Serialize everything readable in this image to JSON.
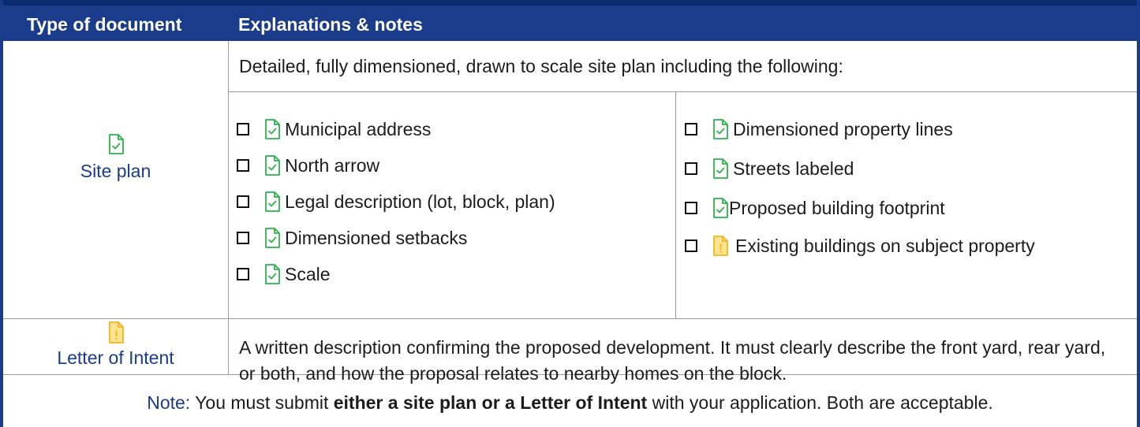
{
  "header": {
    "col1": "Type of document",
    "col2": "Explanations & notes"
  },
  "site_plan": {
    "label": "Site plan",
    "icon": "document-check-icon",
    "icon_color": "#2bb34a",
    "intro": "Detailed, fully dimensioned, drawn to scale site plan including the following:",
    "left_items": [
      {
        "label": "Municipal address",
        "status": "check"
      },
      {
        "label": "North arrow",
        "status": "check"
      },
      {
        "label": "Legal description (lot, block, plan)",
        "status": "check"
      },
      {
        "label": "Dimensioned setbacks",
        "status": "check"
      },
      {
        "label": "Scale",
        "status": "check"
      }
    ],
    "right_items": [
      {
        "label": "Dimensioned property lines",
        "status": "check"
      },
      {
        "label": "Streets labeled",
        "status": "check"
      },
      {
        "label": "Proposed building footprint",
        "status": "check"
      },
      {
        "label": "Existing buildings on subject property",
        "status": "warning"
      }
    ]
  },
  "letter": {
    "label": "Letter of Intent",
    "icon": "document-warning-icon",
    "icon_color": "#f5b324",
    "text": "A written description confirming the proposed development. It must clearly describe the front yard, rear yard, or both, and how the proposal relates to nearby homes on the block."
  },
  "note": {
    "label": "Note:",
    "before": " You must submit ",
    "bold": "either a site plan or a Letter of Intent",
    "after": " with your application. Both are acceptable."
  },
  "colors": {
    "header_bg": "#1a3c8b",
    "check": "#2bb34a",
    "warning": "#f5b324"
  }
}
